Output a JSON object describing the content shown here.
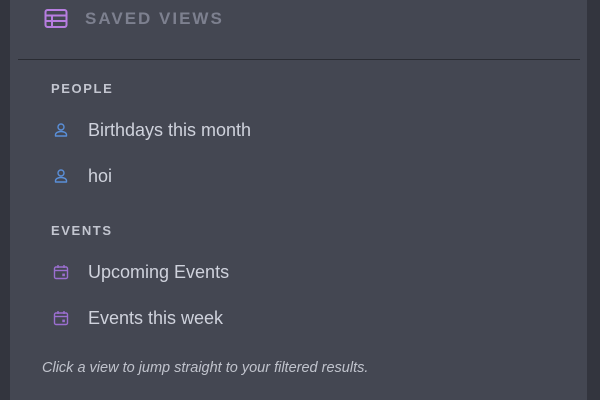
{
  "header": {
    "title": "SAVED VIEWS",
    "icon": "table-icon",
    "accent": "#b77de0"
  },
  "sections": [
    {
      "label": "PEOPLE",
      "icon": "person-icon",
      "icon_color": "#5a8fd8",
      "items": [
        {
          "label": "Birthdays this month"
        },
        {
          "label": "hoi"
        }
      ]
    },
    {
      "label": "EVENTS",
      "icon": "calendar-icon",
      "icon_color": "#9b6fd0",
      "items": [
        {
          "label": "Upcoming Events"
        },
        {
          "label": "Events this week"
        }
      ]
    }
  ],
  "hint": "Click a view to jump straight to your filtered results."
}
